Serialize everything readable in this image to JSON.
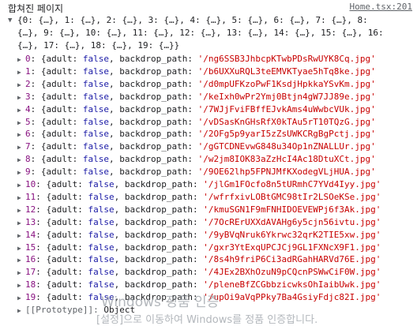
{
  "header": {
    "title": "합쳐진 페이지",
    "source": "Home.tsx:201"
  },
  "summary": {
    "line1": "{0: {…}, 1: {…}, 2: {…}, 3: {…}, 4: {…}, 5: {…}, 6: {…}, 7: {…}, 8:",
    "line2": "{…}, 9: {…}, 10: {…}, 11: {…}, 12: {…}, 13: {…}, 14: {…}, 15: {…}, 16:",
    "line3": "{…}, 17: {…}, 18: {…}, 19: {…}}",
    "info_icon": "i"
  },
  "entries": [
    {
      "index": "0",
      "path": "'/ng6SSB3JhbcpKTwbPDsRwUYK8Cq.jpg'"
    },
    {
      "index": "1",
      "path": "'/b6UXXuRQL3teEMVKTyae5hTq8ke.jpg'"
    },
    {
      "index": "2",
      "path": "'/d0mpUFKzoPwF1KsdjHpkkaYSvKm.jpg'"
    },
    {
      "index": "3",
      "path": "'/keIxh0wPr2Ymj0Btjn4gW7JJ89e.jpg'"
    },
    {
      "index": "4",
      "path": "'/7WJjFviFBffEJvkAms4uWwbcVUk.jpg'"
    },
    {
      "index": "5",
      "path": "'/vDSasKnGHsRfX0kTAu5rT10TQzG.jpg'"
    },
    {
      "index": "6",
      "path": "'/2OFg5p9yarI5zZsUWKCRgBgPctj.jpg'"
    },
    {
      "index": "7",
      "path": "'/gGTCDNEvwG848u34Op1nZNALLUr.jpg'"
    },
    {
      "index": "8",
      "path": "'/w2jm8IOK83aZzHcI4Ac18DtuXCt.jpg'"
    },
    {
      "index": "9",
      "path": "'/9OE62lhp5FPNJMfKXodegVLjHUA.jpg'"
    },
    {
      "index": "10",
      "path": "'/jlGm1FOcfo8n5tURmhC7YVd4Iyy.jpg'"
    },
    {
      "index": "11",
      "path": "'/wfrfxivLOBtGMC98tIr2LSOeKSe.jpg'"
    },
    {
      "index": "12",
      "path": "'/kmuSGN1F9mFNHIDOEVEWPj6f3Ak.jpg'"
    },
    {
      "index": "13",
      "path": "'/7OcRErUXXdAVAHg6y5cjn56ivtu.jpg'"
    },
    {
      "index": "14",
      "path": "'/9yBVqNruk6Ykrwc32qrK2TIE5xw.jpg'"
    },
    {
      "index": "15",
      "path": "'/gxr3YtExqUPCJCj9GL1FXNcX9F1.jpg'"
    },
    {
      "index": "16",
      "path": "'/8s4h9friP6Ci3adRGahHARVd76E.jpg'"
    },
    {
      "index": "17",
      "path": "'/4JEx2BXhOzuN9pCQcnPSWwCiF0W.jpg'"
    },
    {
      "index": "18",
      "path": "'/pleneBfZCGbbzicwksOhIaibUwk.jpg'"
    },
    {
      "index": "19",
      "path": "'/upOi9aVqPPky7Ba4GsiyFdjc82I.jpg'"
    }
  ],
  "entry_text": {
    "open": "{adult: ",
    "adult_value": "false",
    "middle": ", backdrop_path: ",
    "ellipsis": "…"
  },
  "prototype": {
    "label": "[[Prototype]]",
    "value": "Object"
  },
  "watermark": {
    "line1": "Windows 정품 인증",
    "line2": "[설정]으로 이동하여 Windows를 정품 인증합니다."
  }
}
